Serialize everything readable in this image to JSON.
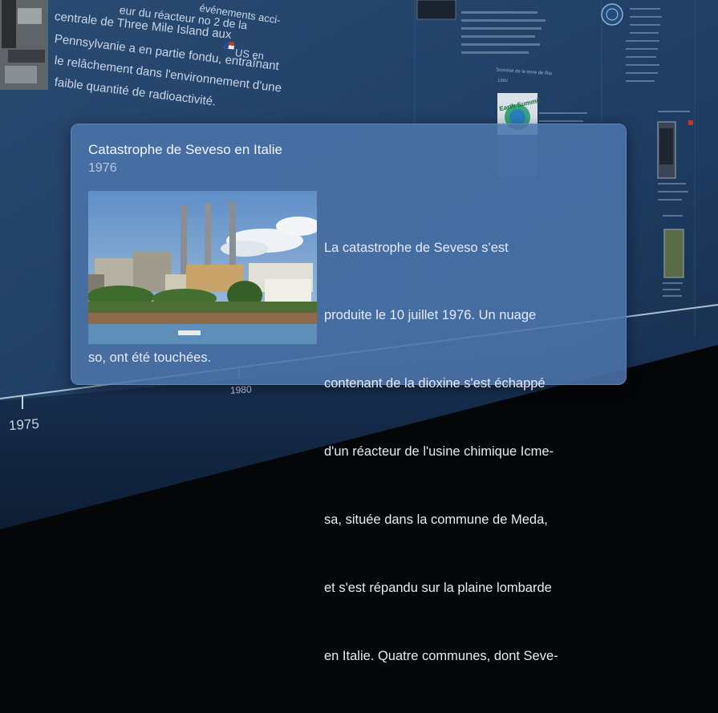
{
  "background": {
    "event_text_lines": [
      "événements acci-",
      "eur du réacteur no 2 de la",
      "centrale de Three Mile Island aux",
      "US en",
      "Pennsylvanie a en partie fondu, entraînant",
      "le relâchement dans l'environnement d'une",
      "faible quantité de radioactivité."
    ],
    "summit_caption": "Sommet de la terre de Rio",
    "summit_year": "1992",
    "summit_logo_text": "Earth Summit",
    "axis_labels": [
      "1975",
      "1980"
    ]
  },
  "card": {
    "title": "Catastrophe de Seveso en Italie",
    "year": "1976",
    "text_lines": [
      "La catastrophe de Seveso s'est",
      "produite le 10 juillet 1976. Un nuage",
      "contenant de la dioxine s'est échappé",
      "d'un réacteur de l'usine chimique Icme-",
      "sa, située dans la commune de Meda,",
      "et s'est répandu sur la plaine lombarde",
      "en Italie. Quatre communes, dont Seve-"
    ],
    "text_last_line": "so, ont été touchées."
  },
  "colors": {
    "card_bg": "#4c74aa",
    "wall": "#1c3a5e",
    "text": "#e3ebf5"
  }
}
